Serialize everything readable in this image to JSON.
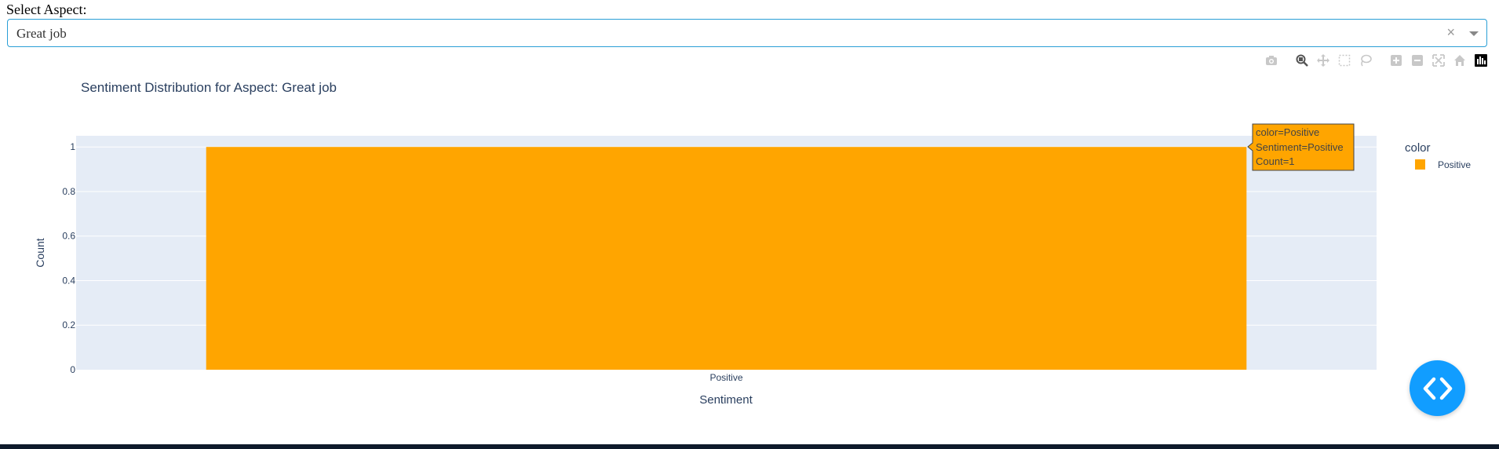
{
  "select": {
    "label": "Select Aspect:",
    "value": "Great job",
    "clear_glyph": "×"
  },
  "modebar": {
    "icons": [
      "camera-icon",
      "zoom-icon",
      "pan-icon",
      "box-select-icon",
      "lasso-icon",
      "zoom-in-icon",
      "zoom-out-icon",
      "autoscale-icon",
      "reset-axes-icon",
      "plotly-logo-icon"
    ]
  },
  "chart_data": {
    "type": "bar",
    "title": "Sentiment Distribution for Aspect: Great job",
    "categories": [
      "Positive"
    ],
    "series": [
      {
        "name": "Positive",
        "values": [
          1
        ],
        "color": "#FFA500"
      }
    ],
    "xlabel": "Sentiment",
    "ylabel": "Count",
    "ylim": [
      0,
      1.05
    ],
    "yticks": [
      0,
      0.2,
      0.4,
      0.6,
      0.8,
      1
    ],
    "ytick_labels": [
      "0",
      "0.2",
      "0.4",
      "0.6",
      "0.8",
      "1"
    ],
    "legend": {
      "title": "color",
      "entries": [
        "Positive"
      ],
      "placement": "right"
    },
    "grid": true,
    "plot_bg": "#E5ECF6",
    "hover_tooltip": {
      "lines": [
        "color=Positive",
        "Sentiment=Positive",
        "Count=1"
      ]
    }
  },
  "fab": {
    "icon": "code-icon",
    "color": "#119DFF"
  }
}
